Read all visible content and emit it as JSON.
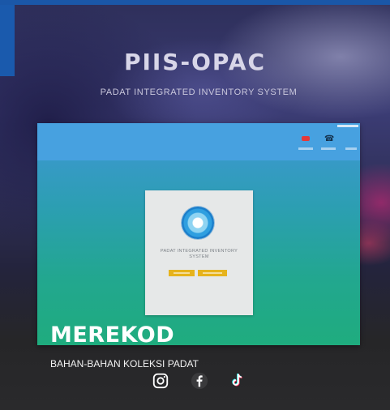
{
  "header": {
    "title": "PIIS-OPAC",
    "subtitle": "PADAT INTEGRATED INVENTORY SYSTEM"
  },
  "screenshot": {
    "topbar_icons": [
      "mail-icon",
      "phone-icon"
    ],
    "card": {
      "text": "PADAT INTEGRATED INVENTORY SYSTEM"
    }
  },
  "footer": {
    "brand": "MEREKOD",
    "tagline": "BAHAN-BAHAN KOLEKSI PADAT",
    "social_icons": [
      "instagram-icon",
      "facebook-icon",
      "tiktok-icon"
    ]
  },
  "colors": {
    "accent_blue": "#1a5aad",
    "button_yellow": "#e6b31c",
    "alert_red": "#e43a3a"
  }
}
